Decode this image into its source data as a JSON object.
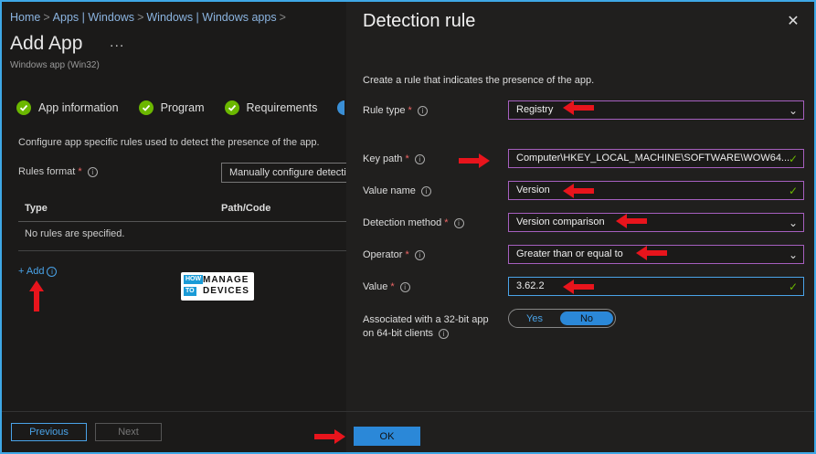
{
  "breadcrumb": [
    "Home",
    "Apps | Windows",
    "Windows | Windows apps"
  ],
  "page": {
    "title": "Add App",
    "more": "...",
    "subtitle": "Windows app (Win32)"
  },
  "steps": [
    "App information",
    "Program",
    "Requirements"
  ],
  "left": {
    "description": "Configure app specific rules used to detect the presence of the app.",
    "rules_format_label": "Rules format",
    "rules_format_value": "Manually configure detection rules",
    "columns": [
      "Type",
      "Path/Code"
    ],
    "empty_text": "No rules are specified.",
    "add_label": "+ Add"
  },
  "logo": {
    "line1": "HOW",
    "line2": "TO",
    "line3": "MANAGE",
    "line4": "DEVICES"
  },
  "footer": {
    "previous": "Previous",
    "next": "Next"
  },
  "dialog": {
    "title": "Detection rule",
    "close_icon": "close-icon",
    "description": "Create a rule that indicates the presence of the app.",
    "fields": {
      "rule_type": {
        "label": "Rule type",
        "value": "Registry"
      },
      "key_path": {
        "label": "Key path",
        "value": "Computer\\HKEY_LOCAL_MACHINE\\SOFTWARE\\WOW64..."
      },
      "value_name": {
        "label": "Value name",
        "value": "Version"
      },
      "detection_method": {
        "label": "Detection method",
        "value": "Version comparison"
      },
      "operator": {
        "label": "Operator",
        "value": "Greater than or equal to"
      },
      "value": {
        "label": "Value",
        "value": "3.62.2"
      }
    },
    "association": {
      "label_line1": "Associated with a 32-bit app",
      "label_line2": "on 64-bit clients",
      "yes": "Yes",
      "no": "No",
      "selected": "No"
    },
    "ok": "OK"
  },
  "colors": {
    "accent": "#2b88d8",
    "success": "#6bb700",
    "required": "#e66666",
    "annotation": "#e8141c",
    "field_border": "#a65fbf"
  }
}
